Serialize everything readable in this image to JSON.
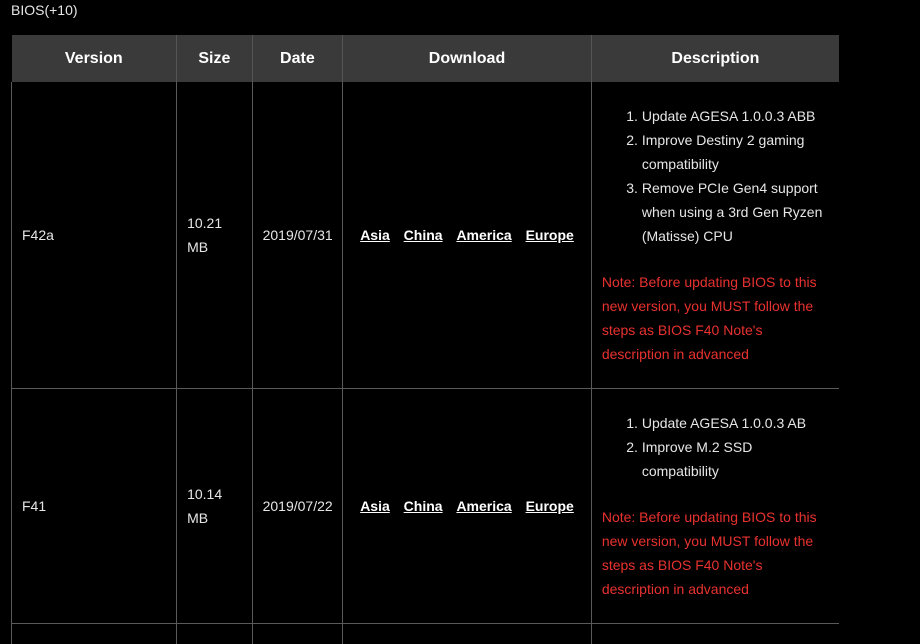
{
  "section": {
    "title": "BIOS(+10)"
  },
  "table": {
    "headers": {
      "version": "Version",
      "size": "Size",
      "date": "Date",
      "download": "Download",
      "description": "Description"
    },
    "rows": [
      {
        "version": "F42a",
        "size_line1": "10.21",
        "size_line2": "MB",
        "date": "2019/07/31",
        "links": [
          "Asia",
          "China",
          "America",
          "Europe"
        ],
        "notes": [
          "Update AGESA 1.0.0.3 ABB",
          "Improve Destiny 2 gaming compatibility",
          "Remove PCIe Gen4 support when using a 3rd Gen Ryzen (Matisse) CPU"
        ],
        "warning": "Note: Before updating BIOS to this new version, you MUST follow the steps as BIOS F40 Note's description in advanced"
      },
      {
        "version": "F41",
        "size_line1": "10.14",
        "size_line2": "MB",
        "date": "2019/07/22",
        "links": [
          "Asia",
          "China",
          "America",
          "Europe"
        ],
        "notes": [
          "Update AGESA 1.0.0.3 AB",
          "Improve M.2 SSD compatibility"
        ],
        "warning": "Note: Before updating BIOS to this new version, you MUST follow the steps as BIOS F40 Note's description in advanced"
      }
    ]
  },
  "colors": {
    "background": "#000000",
    "header_background": "#3a3a3a",
    "warning": "#e8322f",
    "text": "#e6e6e6"
  }
}
